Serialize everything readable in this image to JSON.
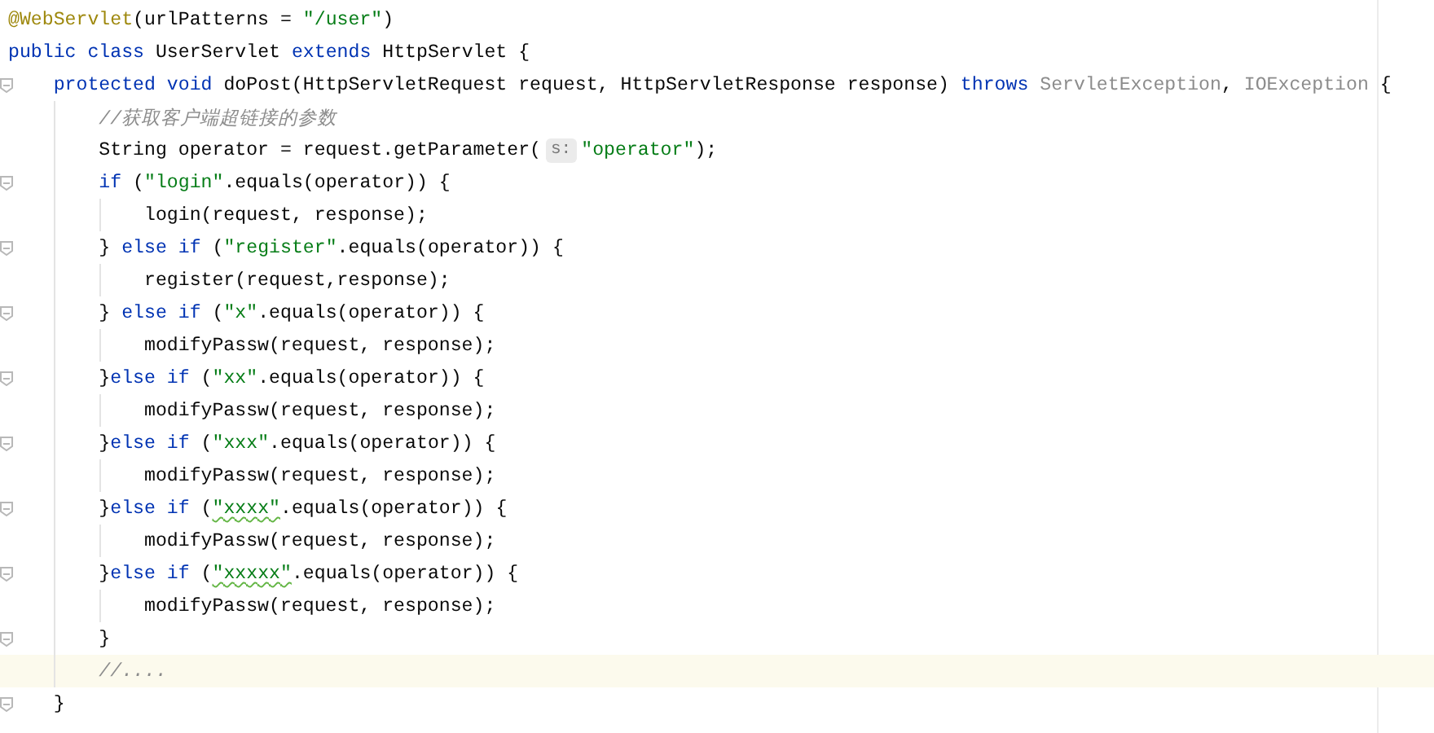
{
  "editor": {
    "lines": [
      {
        "current": false,
        "fold": false,
        "tokens": [
          {
            "kind": "annotation",
            "text": "@WebServlet"
          },
          {
            "kind": "plain",
            "text": "(urlPatterns = "
          },
          {
            "kind": "string",
            "text": "\"/user\""
          },
          {
            "kind": "plain",
            "text": ")"
          }
        ]
      },
      {
        "current": false,
        "fold": false,
        "tokens": [
          {
            "kind": "keyword",
            "text": "public class"
          },
          {
            "kind": "plain",
            "text": " UserServlet "
          },
          {
            "kind": "keyword",
            "text": "extends"
          },
          {
            "kind": "plain",
            "text": " HttpServlet {"
          }
        ]
      },
      {
        "current": false,
        "fold": true,
        "tokens": [
          {
            "kind": "keyword",
            "text": "    protected void"
          },
          {
            "kind": "plain",
            "text": " doPost(HttpServletRequest request, HttpServletResponse response) "
          },
          {
            "kind": "keyword",
            "text": "throws"
          },
          {
            "kind": "unused",
            "text": " ServletException"
          },
          {
            "kind": "plain",
            "text": ", "
          },
          {
            "kind": "unused",
            "text": "IOException"
          },
          {
            "kind": "plain",
            "text": " {"
          }
        ]
      },
      {
        "current": false,
        "fold": false,
        "tokens": [
          {
            "kind": "comment",
            "text": "        //获取客户端超链接的参数"
          }
        ]
      },
      {
        "current": false,
        "fold": false,
        "tokens": [
          {
            "kind": "plain",
            "text": "        String operator = request.getParameter("
          },
          {
            "kind": "hint",
            "text": "s:"
          },
          {
            "kind": "string",
            "text": "\"operator\""
          },
          {
            "kind": "plain",
            "text": ");"
          }
        ]
      },
      {
        "current": false,
        "fold": true,
        "tokens": [
          {
            "kind": "keyword",
            "text": "        if"
          },
          {
            "kind": "plain",
            "text": " ("
          },
          {
            "kind": "string",
            "text": "\"login\""
          },
          {
            "kind": "plain",
            "text": ".equals(operator)) {"
          }
        ]
      },
      {
        "current": false,
        "fold": false,
        "tokens": [
          {
            "kind": "plain",
            "text": "            login(request, response);"
          }
        ]
      },
      {
        "current": false,
        "fold": true,
        "tokens": [
          {
            "kind": "plain",
            "text": "        } "
          },
          {
            "kind": "keyword",
            "text": "else if"
          },
          {
            "kind": "plain",
            "text": " ("
          },
          {
            "kind": "string",
            "text": "\"register\""
          },
          {
            "kind": "plain",
            "text": ".equals(operator)) {"
          }
        ]
      },
      {
        "current": false,
        "fold": false,
        "tokens": [
          {
            "kind": "plain",
            "text": "            register(request,response);"
          }
        ]
      },
      {
        "current": false,
        "fold": true,
        "tokens": [
          {
            "kind": "plain",
            "text": "        } "
          },
          {
            "kind": "keyword",
            "text": "else if"
          },
          {
            "kind": "plain",
            "text": " ("
          },
          {
            "kind": "string",
            "text": "\"x\""
          },
          {
            "kind": "plain",
            "text": ".equals(operator)) {"
          }
        ]
      },
      {
        "current": false,
        "fold": false,
        "tokens": [
          {
            "kind": "plain",
            "text": "            modifyPassw(request, response);"
          }
        ]
      },
      {
        "current": false,
        "fold": true,
        "tokens": [
          {
            "kind": "plain",
            "text": "        }"
          },
          {
            "kind": "keyword",
            "text": "else if"
          },
          {
            "kind": "plain",
            "text": " ("
          },
          {
            "kind": "string",
            "text": "\"xx\""
          },
          {
            "kind": "plain",
            "text": ".equals(operator)) {"
          }
        ]
      },
      {
        "current": false,
        "fold": false,
        "tokens": [
          {
            "kind": "plain",
            "text": "            modifyPassw(request, response);"
          }
        ]
      },
      {
        "current": false,
        "fold": true,
        "tokens": [
          {
            "kind": "plain",
            "text": "        }"
          },
          {
            "kind": "keyword",
            "text": "else if"
          },
          {
            "kind": "plain",
            "text": " ("
          },
          {
            "kind": "string",
            "text": "\"xxx\""
          },
          {
            "kind": "plain",
            "text": ".equals(operator)) {"
          }
        ]
      },
      {
        "current": false,
        "fold": false,
        "tokens": [
          {
            "kind": "plain",
            "text": "            modifyPassw(request, response);"
          }
        ]
      },
      {
        "current": false,
        "fold": true,
        "tokens": [
          {
            "kind": "plain",
            "text": "        }"
          },
          {
            "kind": "keyword",
            "text": "else if"
          },
          {
            "kind": "plain",
            "text": " ("
          },
          {
            "kind": "string",
            "text": "\"xxxx\"",
            "typo": true
          },
          {
            "kind": "plain",
            "text": ".equals(operator)) {"
          }
        ]
      },
      {
        "current": false,
        "fold": false,
        "tokens": [
          {
            "kind": "plain",
            "text": "            modifyPassw(request, response);"
          }
        ]
      },
      {
        "current": false,
        "fold": true,
        "tokens": [
          {
            "kind": "plain",
            "text": "        }"
          },
          {
            "kind": "keyword",
            "text": "else if"
          },
          {
            "kind": "plain",
            "text": " ("
          },
          {
            "kind": "string",
            "text": "\"xxxxx\"",
            "typo": true
          },
          {
            "kind": "plain",
            "text": ".equals(operator)) {"
          }
        ]
      },
      {
        "current": false,
        "fold": false,
        "tokens": [
          {
            "kind": "plain",
            "text": "            modifyPassw(request, response);"
          }
        ]
      },
      {
        "current": false,
        "fold": true,
        "tokens": [
          {
            "kind": "plain",
            "text": "        }"
          }
        ]
      },
      {
        "current": true,
        "fold": false,
        "tokens": [
          {
            "kind": "comment",
            "text": "        //...."
          }
        ]
      },
      {
        "current": false,
        "fold": true,
        "tokens": [
          {
            "kind": "plain",
            "text": "    }"
          }
        ]
      }
    ]
  }
}
